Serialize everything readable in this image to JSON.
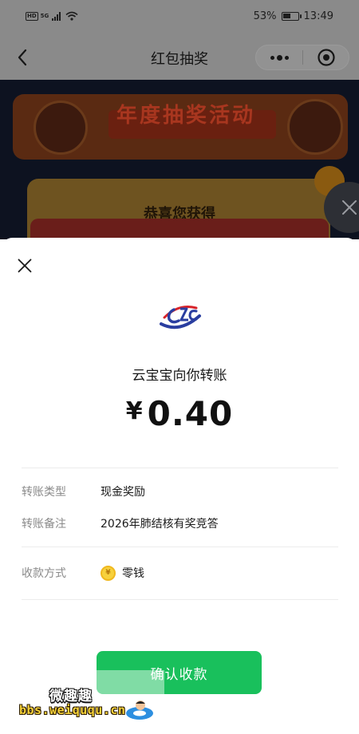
{
  "status_bar": {
    "network_badge": "HD",
    "network_label": "5G",
    "battery_percent": "53%",
    "battery_level": 0.53,
    "time": "13:49"
  },
  "nav": {
    "title": "红包抽奖"
  },
  "background": {
    "banner_text": "年度抽奖活动",
    "dialog_title": "恭喜您获得"
  },
  "sheet": {
    "sender": "云宝宝向你转账",
    "currency": "¥",
    "amount": "0.40",
    "rows": [
      {
        "label": "转账类型",
        "value": "现金奖励"
      },
      {
        "label": "转账备注",
        "value": "2026年肺结核有奖竞答"
      },
      {
        "label": "收款方式",
        "value": "零钱"
      }
    ],
    "confirm_label": "确认收款"
  },
  "watermark": {
    "site_name": "微趣趣",
    "url": "bbs.weiququ.cn"
  },
  "colors": {
    "confirm_green": "#19c05c",
    "coin_yellow": "#f7d13c",
    "overlay_gray": "#8a8a8a",
    "label_gray": "#8a8a8a"
  },
  "icons": [
    "back-arrow-icon",
    "more-dots-icon",
    "mini-program-close-icon",
    "close-icon",
    "wallet-coin-icon",
    "wifi-icon",
    "battery-icon",
    "signal-icon"
  ]
}
